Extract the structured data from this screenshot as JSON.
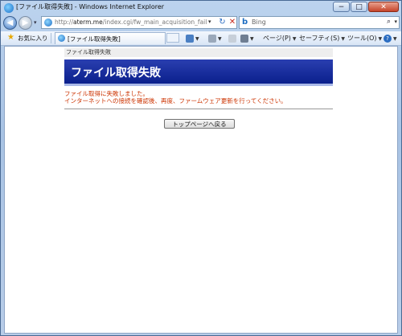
{
  "window": {
    "title": "[ファイル取得失敗] - Windows Internet Explorer",
    "min": "−",
    "max": "□",
    "close": "✕"
  },
  "address": {
    "url_prefix": "http://",
    "url_host": "aterm.me",
    "url_path": "/index.cgi/fw_main_acquisition_failure",
    "dropdown": "▾",
    "refresh": "↻",
    "stop": "✕"
  },
  "search": {
    "placeholder": "Bing",
    "logo": "b",
    "button": "⌕",
    "dropdown": "▾"
  },
  "commandbar": {
    "favorites_label": "お気に入り",
    "tab_label": "[ファイル取得失敗]",
    "page_label": "ページ(P)",
    "safety_label": "セーフティ(S)",
    "tools_label": "ツール(O)",
    "help_label": "?"
  },
  "page": {
    "breadcrumb": "ファイル取得失敗",
    "heading": "ファイル取得失敗",
    "error_line1": "ファイル取得に失敗しました。",
    "error_line2": "インターネットへの接続を確認後、再度、ファームウェア更新を行ってください。",
    "back_button": "トップページへ戻る"
  }
}
